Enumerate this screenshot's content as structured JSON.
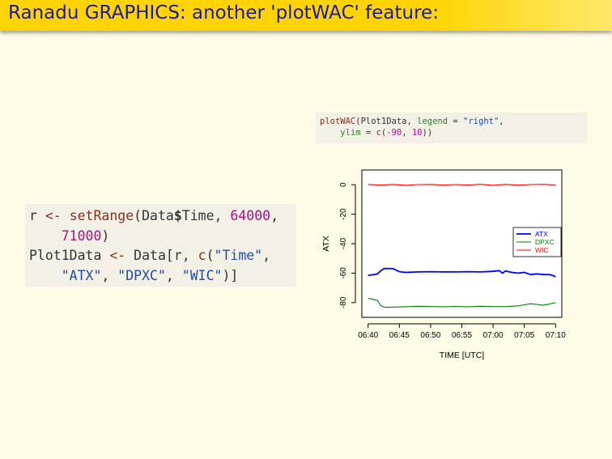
{
  "header": {
    "title": "Ranadu GRAPHICS: another 'plotWAC' feature:"
  },
  "code_left": {
    "line1": {
      "name": "r",
      "assign": "<-",
      "fn": "setRange",
      "arg1": "Data",
      "dollar": "$",
      "arg2": "Time",
      "comma": ", ",
      "n1": "64000",
      "trail": ","
    },
    "line2": {
      "n2": "71000",
      "close": ")"
    },
    "line3": {
      "name": "Plot1Data",
      "assign": "<-",
      "obj": "Data[r, ",
      "fn": "c",
      "open": "(",
      "s1": "\"Time\"",
      "trail": ","
    },
    "line4": {
      "s2": "\"ATX\"",
      "sep1": ", ",
      "s3": "\"DPXC\"",
      "sep2": ", ",
      "s4": "\"WIC\"",
      "close": ")]"
    }
  },
  "code_right": {
    "line1": {
      "fn": "plotWAC",
      "open": "(Plot1Data, ",
      "arg": "legend",
      "eq": " = ",
      "val": "\"right\"",
      "trail": ","
    },
    "line2": {
      "arg": "ylim",
      "eq": " = ",
      "fn": "c",
      "open": "(",
      "n1": "-90",
      "sep": ", ",
      "n2": "10",
      "close": "))"
    }
  },
  "chart_data": {
    "type": "line",
    "xlabel": "TIME [UTC]",
    "ylabel": "ATX",
    "x_ticks": [
      "06:40",
      "06:45",
      "06:50",
      "06:55",
      "07:00",
      "07:05",
      "07:10"
    ],
    "x_tick_minutes": [
      0,
      5,
      10,
      15,
      20,
      25,
      30
    ],
    "xlim_minutes": [
      -1,
      31
    ],
    "y_ticks": [
      0,
      -20,
      -40,
      -60,
      -80
    ],
    "ylim": [
      -90,
      10
    ],
    "legend_position": "right",
    "series": [
      {
        "name": "ATX",
        "color": "#0000ff",
        "x": [
          0,
          1,
          1.5,
          2,
          2.5,
          3,
          4,
          5,
          6,
          8,
          10,
          12,
          14,
          16,
          18,
          20,
          21,
          21.5,
          22,
          23,
          24,
          25,
          26,
          27,
          28,
          29,
          29.5,
          30
        ],
        "values": [
          -61.5,
          -61,
          -60.5,
          -58.5,
          -57,
          -56.8,
          -57,
          -59,
          -59.5,
          -59.2,
          -59,
          -59.2,
          -59.2,
          -59,
          -59.2,
          -58.8,
          -58.3,
          -60,
          -58.5,
          -59.5,
          -60,
          -59.5,
          -61,
          -60.5,
          -61,
          -61,
          -61.5,
          -62.5
        ]
      },
      {
        "name": "DPXC",
        "color": "#008000",
        "x": [
          0,
          1,
          1.5,
          2,
          2.5,
          3,
          4,
          6,
          8,
          10,
          12,
          14,
          16,
          18,
          20,
          22,
          24,
          25,
          26,
          27,
          28,
          29,
          30
        ],
        "values": [
          -77,
          -78,
          -78.5,
          -82,
          -83,
          -83.2,
          -83,
          -82.8,
          -82.5,
          -82.7,
          -82.8,
          -82.6,
          -82.8,
          -82.5,
          -82.7,
          -82.7,
          -82.2,
          -81.5,
          -80.8,
          -81.2,
          -81.8,
          -81,
          -80
        ]
      },
      {
        "name": "WIC",
        "color": "#ff0000",
        "x": [
          0,
          2,
          4,
          6,
          8,
          10,
          12,
          14,
          16,
          18,
          20,
          22,
          24,
          26,
          28,
          30
        ],
        "values": [
          0.2,
          -0.3,
          0.2,
          -0.4,
          0.1,
          0.2,
          -0.3,
          0.1,
          -0.2,
          0.3,
          -0.4,
          0.2,
          -0.3,
          0.1,
          0.3,
          -0.2
        ]
      }
    ]
  }
}
